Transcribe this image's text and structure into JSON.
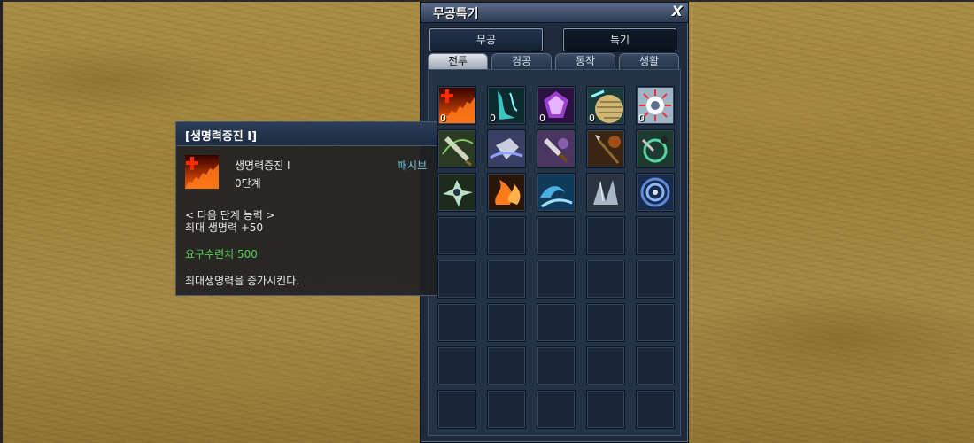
{
  "window": {
    "title": "무공특기",
    "close": "X",
    "buttons": [
      "무공",
      "특기"
    ],
    "selected_button": 1,
    "tabs": [
      "전투",
      "경공",
      "동작",
      "생활"
    ],
    "active_tab": 0
  },
  "skills": [
    {
      "name": "life-boost-skill",
      "level": "0"
    },
    {
      "name": "spirit-foot-skill",
      "level": "0"
    },
    {
      "name": "crystal-shield-skill",
      "level": "0"
    },
    {
      "name": "scale-armor-skill",
      "level": "0"
    },
    {
      "name": "light-gear-skill",
      "level": "0"
    },
    {
      "name": "blade-sweep-skill",
      "level": ""
    },
    {
      "name": "palm-strike-skill",
      "level": ""
    },
    {
      "name": "dagger-skill",
      "level": ""
    },
    {
      "name": "spear-skill",
      "level": ""
    },
    {
      "name": "chain-ring-skill",
      "level": ""
    },
    {
      "name": "spin-blade-skill",
      "level": ""
    },
    {
      "name": "flame-skill",
      "level": ""
    },
    {
      "name": "wave-skill",
      "level": ""
    },
    {
      "name": "ice-shard-skill",
      "level": ""
    },
    {
      "name": "vortex-skill",
      "level": ""
    }
  ],
  "tooltip": {
    "title": "[생명력증진 I]",
    "skill_name": "생명력증진 I",
    "type": "패시브",
    "level": "0단계",
    "next_header": "< 다음 단계 능력 >",
    "next_effect": "최대 생명력 +50",
    "requirement": "요구수련치 500",
    "description": "최대생명력을 증가시킨다."
  }
}
